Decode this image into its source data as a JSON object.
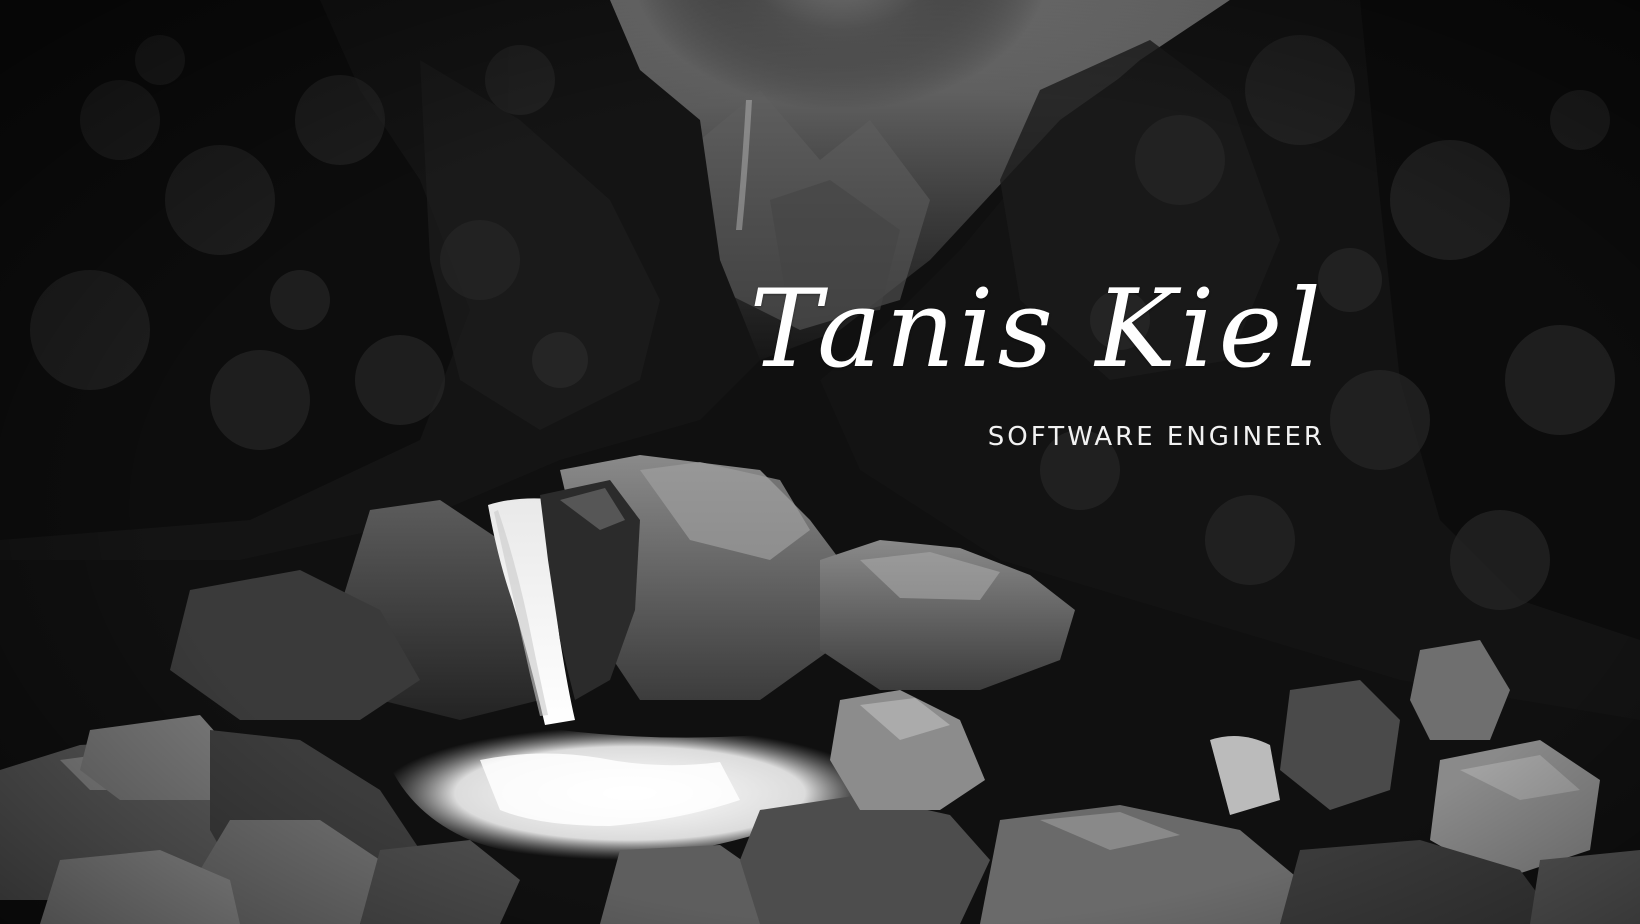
{
  "hero": {
    "name": "Tanis Kiel",
    "title": "SOFTWARE ENGINEER",
    "background": {
      "subject": "black-and-white photo of a waterfall in a misty mountain gorge",
      "colors": {
        "dark": "#0b0b0b",
        "mist": "#8a8a8a",
        "water": "#f4f4f4",
        "rock": "#6e6e6e"
      }
    }
  }
}
